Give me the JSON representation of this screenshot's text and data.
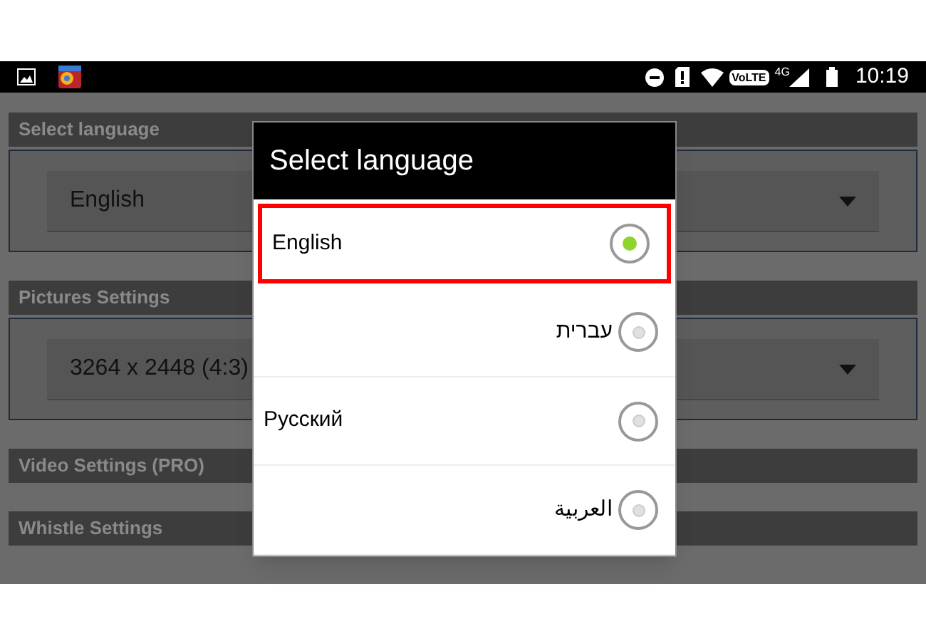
{
  "status_bar": {
    "network": "VoLTE",
    "generation": "4G",
    "time": "10:19"
  },
  "settings": [
    {
      "title": "Select language",
      "dropdown": "English"
    },
    {
      "title": "Pictures Settings",
      "dropdown": "3264 x 2448 (4:3)"
    },
    {
      "title": "Video Settings (PRO)"
    },
    {
      "title": "Whistle Settings"
    }
  ],
  "dialog": {
    "title": "Select language",
    "options": [
      {
        "label": "English",
        "rtl": false,
        "selected": true,
        "highlighted": true
      },
      {
        "label": "עברית",
        "rtl": true,
        "selected": false,
        "highlighted": false
      },
      {
        "label": "Русский",
        "rtl": false,
        "selected": false,
        "highlighted": false
      },
      {
        "label": "العربية",
        "rtl": true,
        "selected": false,
        "highlighted": false
      }
    ]
  }
}
